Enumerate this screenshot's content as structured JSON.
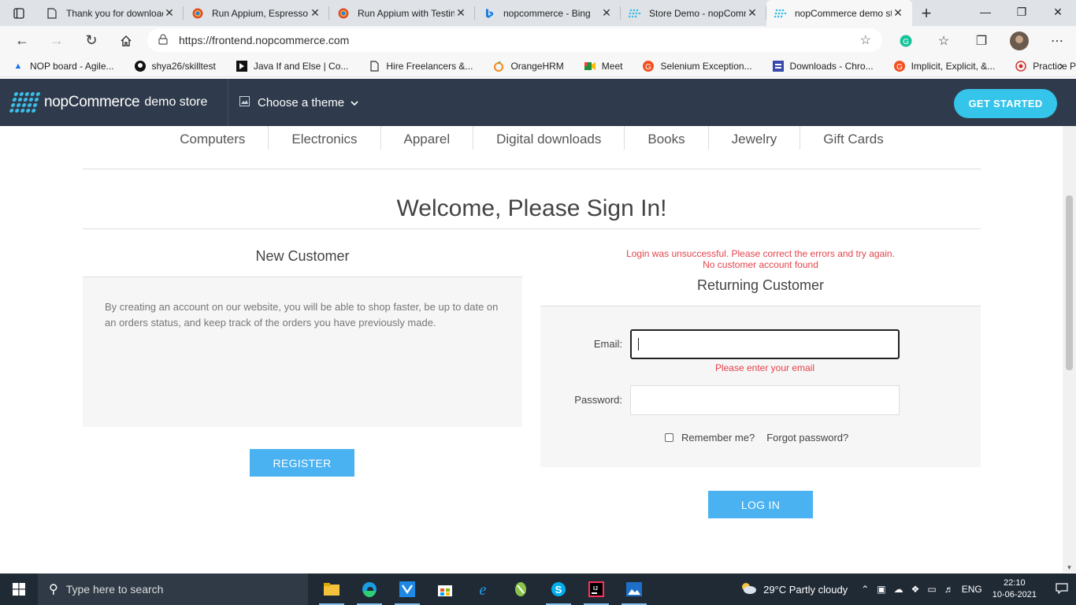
{
  "browser": {
    "tabs": [
      {
        "title": "Thank you for downloading",
        "icon": "document-icon"
      },
      {
        "title": "Run Appium, Espresso",
        "icon": "chrome-icon"
      },
      {
        "title": "Run Appium with Testing",
        "icon": "chrome-icon"
      },
      {
        "title": "nopcommerce - Bing",
        "icon": "bing-icon"
      },
      {
        "title": "Store Demo - nopCommerce",
        "icon": "nop-icon"
      },
      {
        "title": "nopCommerce demo store",
        "icon": "nop-icon"
      }
    ],
    "close_glyph": "✕",
    "new_tab": "+",
    "url": "https://frontend.nopcommerce.com",
    "bookmarks": [
      {
        "label": "NOP board - Agile...",
        "icon": "azure-icon"
      },
      {
        "label": "shya26/skilltest",
        "icon": "github-icon"
      },
      {
        "label": "Java If and Else | Co...",
        "icon": "java-icon"
      },
      {
        "label": "Hire Freelancers &...",
        "icon": "document-icon"
      },
      {
        "label": "OrangeHRM",
        "icon": "orange-icon"
      },
      {
        "label": "Meet",
        "icon": "meet-icon"
      },
      {
        "label": "Selenium Exception...",
        "icon": "g-icon"
      },
      {
        "label": "Downloads - Chro...",
        "icon": "downloads-icon"
      },
      {
        "label": "Implicit, Explicit, &...",
        "icon": "g-icon"
      },
      {
        "label": "Practice Page",
        "icon": "practice-icon"
      }
    ]
  },
  "site": {
    "logo_main": "nopCommerce",
    "logo_sub": "demo store",
    "theme_label": "Choose a theme",
    "get_started": "GET STARTED",
    "menu": [
      "Computers",
      "Electronics",
      "Apparel",
      "Digital downloads",
      "Books",
      "Jewelry",
      "Gift Cards"
    ]
  },
  "login": {
    "page_title": "Welcome, Please Sign In!",
    "new_customer": {
      "title": "New Customer",
      "text": "By creating an account on our website, you will be able to shop faster, be up to date on an orders status, and keep track of the orders you have previously made.",
      "register": "REGISTER"
    },
    "errors": [
      "Login was unsuccessful. Please correct the errors and try again.",
      "No customer account found"
    ],
    "returning": {
      "title": "Returning Customer",
      "email_label": "Email:",
      "email_value": "",
      "email_error": "Please enter your email",
      "password_label": "Password:",
      "remember": "Remember me?",
      "forgot": "Forgot password?",
      "login": "LOG IN"
    }
  },
  "taskbar": {
    "search_placeholder": "Type here to search",
    "weather": "29°C  Partly cloudy",
    "lang": "ENG",
    "time": "22:10",
    "date": "10-06-2021"
  },
  "colors": {
    "header_bg": "#2f3b4c",
    "accent": "#35c4ea",
    "button": "#4ab2f1",
    "error": "#e4434b"
  }
}
